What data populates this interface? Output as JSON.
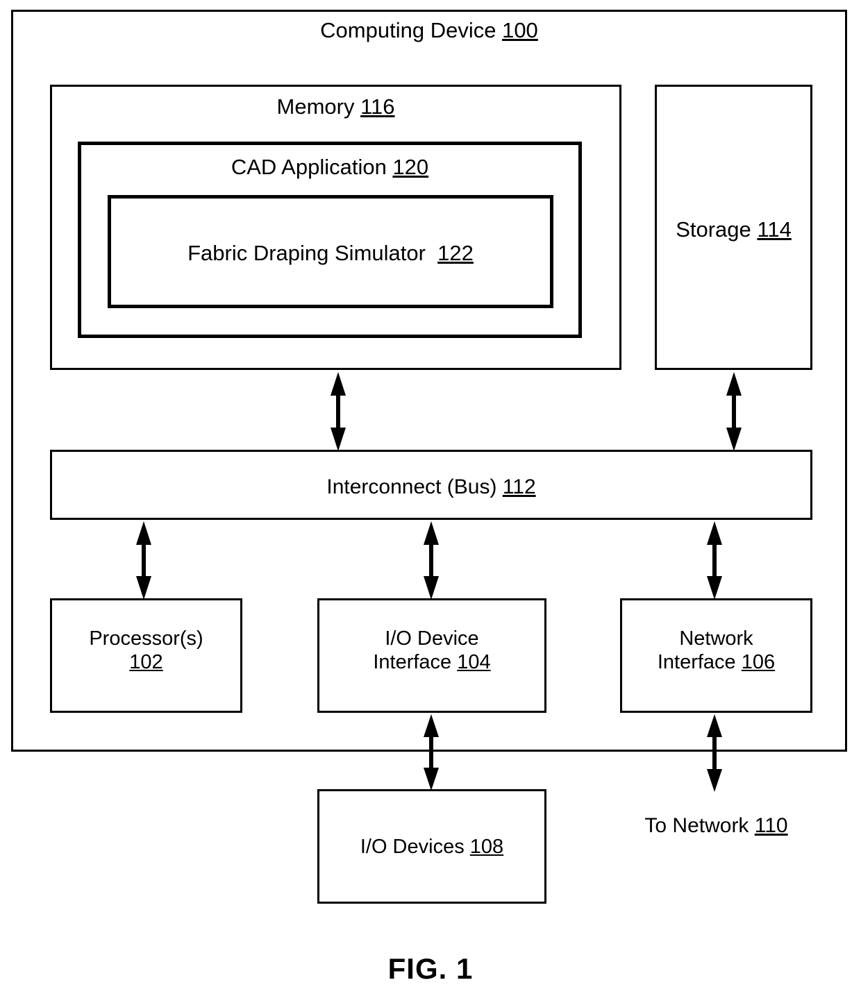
{
  "figure": {
    "caption": "FIG. 1",
    "outer": {
      "title_text": "Computing Device ",
      "title_ref": "100"
    },
    "blocks": [
      {
        "id": "memory",
        "line1": "Memory ",
        "ref1": "116"
      },
      {
        "id": "cad-application",
        "line1": "CAD Application ",
        "ref1": "120"
      },
      {
        "id": "fabric-simulator",
        "line1": "Fabric Draping Simulator  ",
        "ref1": "122"
      },
      {
        "id": "storage",
        "line1": "Storage ",
        "ref1": "114"
      },
      {
        "id": "interconnect-bus",
        "line1": "Interconnect (Bus) ",
        "ref1": "112"
      },
      {
        "id": "processors",
        "line1": "Processor(s)",
        "line2": "",
        "ref2": "102"
      },
      {
        "id": "io-device-interface",
        "line1": "I/O Device",
        "line2": "Interface ",
        "ref2": "104"
      },
      {
        "id": "network-interface",
        "line1": "Network",
        "line2": "Interface ",
        "ref2": "106"
      },
      {
        "id": "io-devices",
        "line1": "I/O Devices ",
        "ref1": "108"
      }
    ],
    "external_label": {
      "text": "To Network ",
      "ref": "110"
    },
    "connectors": [
      {
        "id": "memory-to-bus",
        "from": "memory",
        "to": "interconnect-bus",
        "style": "double-arrow"
      },
      {
        "id": "storage-to-bus",
        "from": "storage",
        "to": "interconnect-bus",
        "style": "double-arrow"
      },
      {
        "id": "bus-to-processors",
        "from": "interconnect-bus",
        "to": "processors",
        "style": "double-arrow"
      },
      {
        "id": "bus-to-io-interface",
        "from": "interconnect-bus",
        "to": "io-device-interface",
        "style": "double-arrow"
      },
      {
        "id": "bus-to-network-interface",
        "from": "interconnect-bus",
        "to": "network-interface",
        "style": "double-arrow"
      },
      {
        "id": "io-interface-to-devices",
        "from": "io-device-interface",
        "to": "io-devices",
        "style": "double-arrow"
      },
      {
        "id": "network-interface-to-net",
        "from": "network-interface",
        "to": "to-network",
        "style": "double-arrow"
      }
    ],
    "colors": {
      "stroke": "#000000",
      "background": "#ffffff"
    }
  }
}
